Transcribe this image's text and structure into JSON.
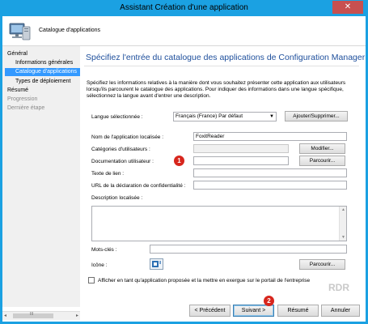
{
  "window": {
    "title": "Assistant Création d'une application",
    "close_glyph": "✕"
  },
  "header": {
    "title": "Catalogue d'applications",
    "icon": "computer-icon"
  },
  "nav": {
    "items": [
      {
        "label": "Général",
        "state": "normal"
      },
      {
        "label": "Informations générales",
        "state": "normal"
      },
      {
        "label": "Catalogue d'applications",
        "state": "selected"
      },
      {
        "label": "Types de déploiement",
        "state": "normal"
      },
      {
        "label": "Résumé",
        "state": "normal"
      },
      {
        "label": "Progression",
        "state": "disabled"
      },
      {
        "label": "Dernière étape",
        "state": "disabled"
      }
    ],
    "scroll_left": "◂",
    "scroll_right": "▸",
    "scroll_grip": "III"
  },
  "main": {
    "heading": "Spécifiez l'entrée du catalogue des applications de Configuration Manager",
    "description": "Spécifiez les informations relatives à la manière dont vous souhaitez présenter cette application aux utilisateurs lorsqu'ils parcourent le catalogue des applications. Pour indiquer des informations dans une langue spécifique, sélectionnez la langue avant d'entrer une description.",
    "language_label": "Langue sélectionnée :",
    "language_value": "Français (France) Par défaut",
    "add_remove_button": "Ajouter/Supprimer...",
    "app_name_label": "Nom de l'application localisée :",
    "app_name_value": "FoxitReader",
    "categories_label": "Catégories d'utilisateurs :",
    "modify_button": "Modifier...",
    "doc_label": "Documentation utilisateur :",
    "browse_button": "Parcourir...",
    "link_text_label": "Texte de lien :",
    "privacy_label": "URL de la déclaration de confidentialité :",
    "localized_desc_label": "Description localisée :",
    "keywords_label": "Mots-clés :",
    "icon_label": "Icône :",
    "icon_browse_button": "Parcourir...",
    "featured_label": "Afficher en tant qu'application proposée et la mettre en exergue sur le portail de l'entreprise",
    "featured_checked": false
  },
  "footer": {
    "previous": "< Précédent",
    "next": "Suivant >",
    "summary": "Résumé",
    "cancel": "Annuler"
  },
  "annotations": {
    "badge1": "1",
    "badge2": "2",
    "color": "#d7261d"
  },
  "watermark": "RDR"
}
